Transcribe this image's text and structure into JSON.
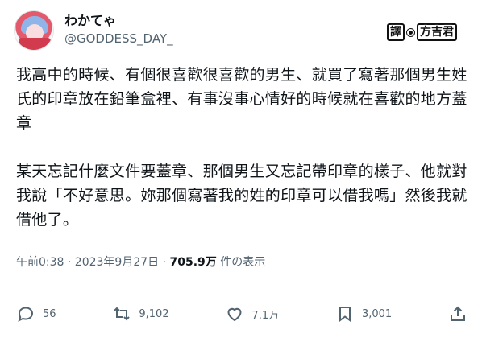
{
  "user": {
    "display_name": "わかてゃ",
    "handle": "@GODDESS_DAY_",
    "avatar_icon": "avatar-anime-girl"
  },
  "badge": {
    "part1": "譯",
    "part2": "方吉君"
  },
  "tweet": {
    "paragraph1": "我高中的時候、有個很喜歡很喜歡的男生、就買了寫著那個男生姓氏的印章放在鉛筆盒裡、有事沒事心情好的時候就在喜歡的地方蓋章",
    "paragraph2": "某天忘記什麼文件要蓋章、那個男生又忘記帶印章的樣子、他就對我說「不好意思。妳那個寫著我的姓的印章可以借我嗎」然後我就借他了。"
  },
  "meta": {
    "timestamp": "午前0:38 · 2023年9月27日 · ",
    "views": "705.9万",
    "views_suffix": " 件の表示"
  },
  "actions": {
    "replies": "56",
    "retweets": "9,102",
    "likes": "7.1万",
    "bookmarks": "3,001"
  }
}
